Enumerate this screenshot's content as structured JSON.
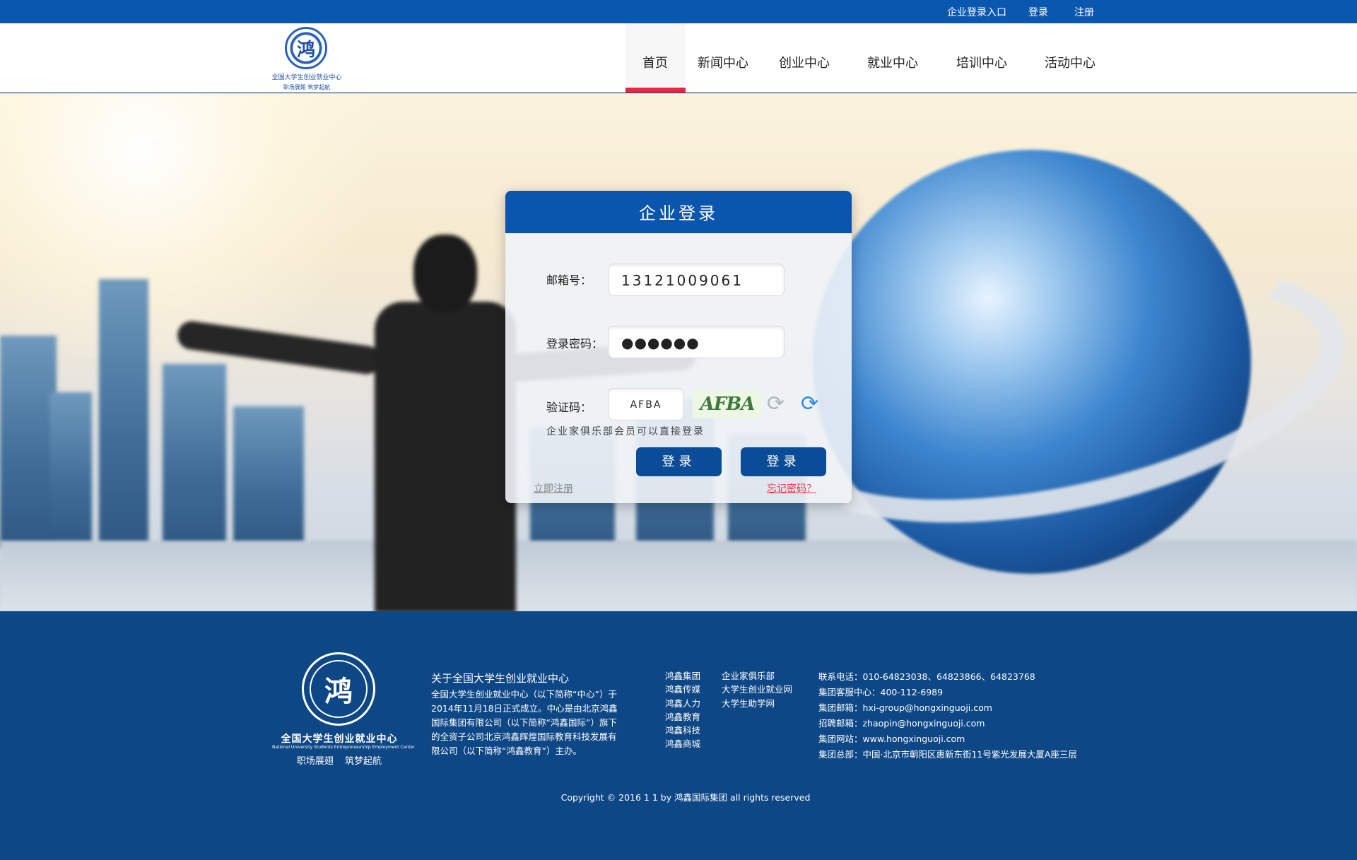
{
  "topbar": {
    "enterprise_login": "企业登录入口",
    "login": "登录",
    "register": "注册"
  },
  "header": {
    "logo_title": "全国大学生创业就业中心",
    "logo_slogan": "职场展翅    筑梦起航",
    "nav": [
      {
        "label": "首页",
        "active": true
      },
      {
        "label": "新闻中心"
      },
      {
        "label": "创业中心"
      },
      {
        "label": "就业中心"
      },
      {
        "label": "培训中心"
      },
      {
        "label": "活动中心"
      }
    ]
  },
  "login_card": {
    "title": "企业登录",
    "email_label": "邮箱号：",
    "email_value": "13121009061",
    "password_label": "登录密码：",
    "password_value": "●●●●●●",
    "captcha_label": "验证码：",
    "captcha_value": "AFBA",
    "captcha_image_text": "AFBA",
    "hint": "企业家俱乐部会员可以直接登录",
    "button1": "登录",
    "button2": "登录",
    "register_link": "立即注册",
    "forgot_link": "忘记密码？"
  },
  "footer": {
    "logo_title": "全国大学生创业就业中心",
    "logo_english": "National University Students Entrepreneurship Employment Center",
    "logo_slogan": "职场展翅 筑梦起航",
    "about_title": "关于全国大学生创业就业中心",
    "about_text": "全国大学生创业就业中心（以下简称“中心”）于2014年11月18日正式成立。中心是由北京鸿鑫国际集团有限公司（以下简称“鸿鑫国际”）旗下的全资子公司北京鸿鑫辉煌国际教育科技发展有限公司（以下简称“鸿鑫教育”）主办。",
    "links_col1": [
      "鸿鑫集团",
      "鸿鑫传媒",
      "鸿鑫人力",
      "鸿鑫教育",
      "鸿鑫科技",
      "鸿鑫商城"
    ],
    "links_col2": [
      "企业家俱乐部",
      "大学生创业就业网",
      "大学生助学网"
    ],
    "contact": [
      "联系电话：010-64823038、64823866、64823768",
      "集团客服中心：400-112-6989",
      "集团邮箱：hxi-group@hongxinguoji.com",
      "招聘邮箱：zhaopin@hongxinguoji.com",
      "集团网站：www.hongxinguoji.com",
      "集团总部：中国·北京市朝阳区惠新东街11号紫光发展大厦A座三层"
    ],
    "copyright": "Copyright © 2016 1 1 by 鸿鑫国际集团 all rights reserved"
  },
  "colors": {
    "primary_blue": "#0a55ad",
    "footer_blue": "#0e4786",
    "accent_red": "#e32845"
  }
}
